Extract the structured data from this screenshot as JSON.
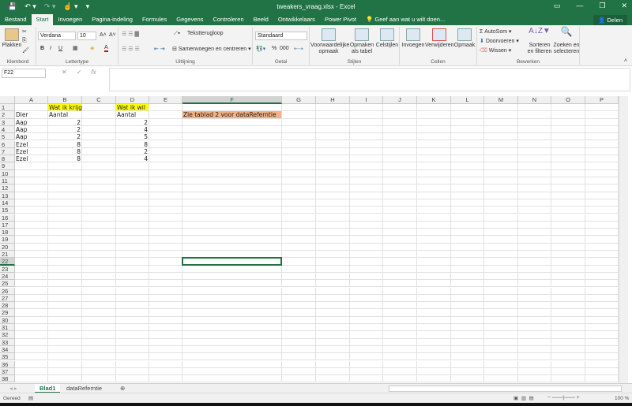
{
  "window": {
    "title": "tweakers_vraag.xlsx - Excel",
    "minimize": "—",
    "restore": "❐",
    "close": "✕",
    "ribbon_display": "▭"
  },
  "qat": {
    "save": "💾",
    "undo": "↶ ▾",
    "redo": "↷ ▾",
    "touch": "☝ ▾",
    "customize": "▾"
  },
  "tabs": [
    "Bestand",
    "Start",
    "Invoegen",
    "Pagina-indeling",
    "Formules",
    "Gegevens",
    "Controleren",
    "Beeld",
    "Ontwikkelaars",
    "Power Pivot"
  ],
  "tell_me": "💡 Geef aan wat u wilt doen...",
  "share": "Delen",
  "ribbon": {
    "clipboard": {
      "paste": "Plakken",
      "label": "Klembord"
    },
    "font": {
      "name": "Verdana",
      "size": "10",
      "bold": "B",
      "italic": "I",
      "underline": "U",
      "grow": "A˄",
      "shrink": "A˅",
      "color": "A",
      "label": "Lettertype"
    },
    "alignment": {
      "wrap": "Tekstterugloop",
      "merge": "Samenvoegen en centreren",
      "label": "Uitlijning"
    },
    "number": {
      "format": "Standaard",
      "percent": "%",
      "thousands": "000",
      "label": "Getal"
    },
    "styles": {
      "conditional": "Voorwaardelijke opmaak",
      "table": "Opmaken als tabel",
      "cell": "Celstijlen",
      "label": "Stijlen"
    },
    "cells": {
      "insert": "Invoegen",
      "delete": "Verwijderen",
      "format": "Opmaak",
      "label": "Cellen"
    },
    "editing": {
      "autosum": "AutoSom",
      "fill": "Doorvoeren",
      "clear": "Wissen",
      "sort": "Sorteren en filteren",
      "find": "Zoeken en selecteren",
      "label": "Bewerken"
    }
  },
  "formula_bar": {
    "name_box": "F22",
    "cancel": "✕",
    "enter": "✓",
    "fx": "fx",
    "value": ""
  },
  "columns": [
    "A",
    "B",
    "C",
    "D",
    "E",
    "F",
    "G",
    "H",
    "I",
    "J",
    "K",
    "L",
    "M",
    "N",
    "O",
    "P"
  ],
  "row_count": 38,
  "selected": {
    "col": "F",
    "row": 22
  },
  "cells": [
    {
      "ref": "B1",
      "v": "Wat ik krijg",
      "fill": "#ffff00"
    },
    {
      "ref": "D1",
      "v": "Wat ik wil",
      "fill": "#ffff00"
    },
    {
      "ref": "A2",
      "v": "Dier"
    },
    {
      "ref": "B2",
      "v": "Aantal"
    },
    {
      "ref": "D2",
      "v": "Aantal"
    },
    {
      "ref": "F2",
      "v": "Zie tablad 2 voor dataReferntie",
      "fill": "#f4b183"
    },
    {
      "ref": "A3",
      "v": "Aap"
    },
    {
      "ref": "B3",
      "v": "2",
      "num": true
    },
    {
      "ref": "D3",
      "v": "2",
      "num": true
    },
    {
      "ref": "A4",
      "v": "Aap"
    },
    {
      "ref": "B4",
      "v": "2",
      "num": true
    },
    {
      "ref": "D4",
      "v": "4",
      "num": true
    },
    {
      "ref": "A5",
      "v": "Aap"
    },
    {
      "ref": "B5",
      "v": "2",
      "num": true
    },
    {
      "ref": "D5",
      "v": "5",
      "num": true
    },
    {
      "ref": "A6",
      "v": "Ezel"
    },
    {
      "ref": "B6",
      "v": "8",
      "num": true
    },
    {
      "ref": "D6",
      "v": "8",
      "num": true
    },
    {
      "ref": "A7",
      "v": "Ezel"
    },
    {
      "ref": "B7",
      "v": "8",
      "num": true
    },
    {
      "ref": "D7",
      "v": "2",
      "num": true
    },
    {
      "ref": "A8",
      "v": "Ezel"
    },
    {
      "ref": "B8",
      "v": "8",
      "num": true
    },
    {
      "ref": "D8",
      "v": "4",
      "num": true
    }
  ],
  "sheets": [
    {
      "name": "Blad1",
      "active": true
    },
    {
      "name": "dataReferntie",
      "active": false
    }
  ],
  "add_sheet": "⊕",
  "status": {
    "text": "Gereed",
    "zoom": "100 %"
  },
  "colors": {
    "brand": "#217346"
  }
}
